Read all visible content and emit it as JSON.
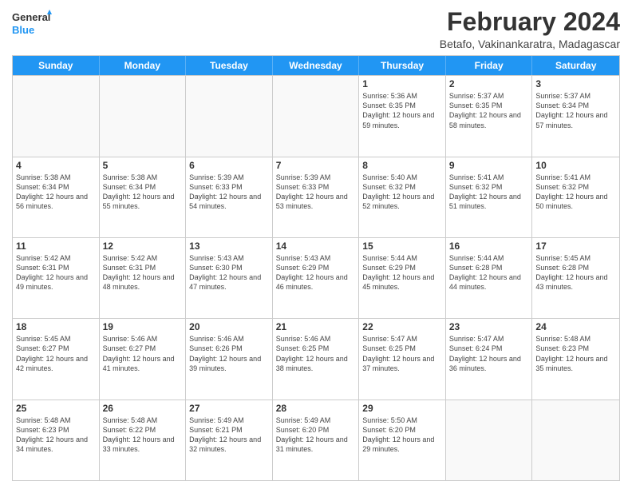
{
  "logo": {
    "text_general": "General",
    "text_blue": "Blue"
  },
  "header": {
    "title": "February 2024",
    "subtitle": "Betafo, Vakinankaratra, Madagascar"
  },
  "days_of_week": [
    "Sunday",
    "Monday",
    "Tuesday",
    "Wednesday",
    "Thursday",
    "Friday",
    "Saturday"
  ],
  "weeks": [
    [
      {
        "day": "",
        "detail": ""
      },
      {
        "day": "",
        "detail": ""
      },
      {
        "day": "",
        "detail": ""
      },
      {
        "day": "",
        "detail": ""
      },
      {
        "day": "1",
        "detail": "Sunrise: 5:36 AM\nSunset: 6:35 PM\nDaylight: 12 hours and 59 minutes."
      },
      {
        "day": "2",
        "detail": "Sunrise: 5:37 AM\nSunset: 6:35 PM\nDaylight: 12 hours and 58 minutes."
      },
      {
        "day": "3",
        "detail": "Sunrise: 5:37 AM\nSunset: 6:34 PM\nDaylight: 12 hours and 57 minutes."
      }
    ],
    [
      {
        "day": "4",
        "detail": "Sunrise: 5:38 AM\nSunset: 6:34 PM\nDaylight: 12 hours and 56 minutes."
      },
      {
        "day": "5",
        "detail": "Sunrise: 5:38 AM\nSunset: 6:34 PM\nDaylight: 12 hours and 55 minutes."
      },
      {
        "day": "6",
        "detail": "Sunrise: 5:39 AM\nSunset: 6:33 PM\nDaylight: 12 hours and 54 minutes."
      },
      {
        "day": "7",
        "detail": "Sunrise: 5:39 AM\nSunset: 6:33 PM\nDaylight: 12 hours and 53 minutes."
      },
      {
        "day": "8",
        "detail": "Sunrise: 5:40 AM\nSunset: 6:32 PM\nDaylight: 12 hours and 52 minutes."
      },
      {
        "day": "9",
        "detail": "Sunrise: 5:41 AM\nSunset: 6:32 PM\nDaylight: 12 hours and 51 minutes."
      },
      {
        "day": "10",
        "detail": "Sunrise: 5:41 AM\nSunset: 6:32 PM\nDaylight: 12 hours and 50 minutes."
      }
    ],
    [
      {
        "day": "11",
        "detail": "Sunrise: 5:42 AM\nSunset: 6:31 PM\nDaylight: 12 hours and 49 minutes."
      },
      {
        "day": "12",
        "detail": "Sunrise: 5:42 AM\nSunset: 6:31 PM\nDaylight: 12 hours and 48 minutes."
      },
      {
        "day": "13",
        "detail": "Sunrise: 5:43 AM\nSunset: 6:30 PM\nDaylight: 12 hours and 47 minutes."
      },
      {
        "day": "14",
        "detail": "Sunrise: 5:43 AM\nSunset: 6:29 PM\nDaylight: 12 hours and 46 minutes."
      },
      {
        "day": "15",
        "detail": "Sunrise: 5:44 AM\nSunset: 6:29 PM\nDaylight: 12 hours and 45 minutes."
      },
      {
        "day": "16",
        "detail": "Sunrise: 5:44 AM\nSunset: 6:28 PM\nDaylight: 12 hours and 44 minutes."
      },
      {
        "day": "17",
        "detail": "Sunrise: 5:45 AM\nSunset: 6:28 PM\nDaylight: 12 hours and 43 minutes."
      }
    ],
    [
      {
        "day": "18",
        "detail": "Sunrise: 5:45 AM\nSunset: 6:27 PM\nDaylight: 12 hours and 42 minutes."
      },
      {
        "day": "19",
        "detail": "Sunrise: 5:46 AM\nSunset: 6:27 PM\nDaylight: 12 hours and 41 minutes."
      },
      {
        "day": "20",
        "detail": "Sunrise: 5:46 AM\nSunset: 6:26 PM\nDaylight: 12 hours and 39 minutes."
      },
      {
        "day": "21",
        "detail": "Sunrise: 5:46 AM\nSunset: 6:25 PM\nDaylight: 12 hours and 38 minutes."
      },
      {
        "day": "22",
        "detail": "Sunrise: 5:47 AM\nSunset: 6:25 PM\nDaylight: 12 hours and 37 minutes."
      },
      {
        "day": "23",
        "detail": "Sunrise: 5:47 AM\nSunset: 6:24 PM\nDaylight: 12 hours and 36 minutes."
      },
      {
        "day": "24",
        "detail": "Sunrise: 5:48 AM\nSunset: 6:23 PM\nDaylight: 12 hours and 35 minutes."
      }
    ],
    [
      {
        "day": "25",
        "detail": "Sunrise: 5:48 AM\nSunset: 6:23 PM\nDaylight: 12 hours and 34 minutes."
      },
      {
        "day": "26",
        "detail": "Sunrise: 5:48 AM\nSunset: 6:22 PM\nDaylight: 12 hours and 33 minutes."
      },
      {
        "day": "27",
        "detail": "Sunrise: 5:49 AM\nSunset: 6:21 PM\nDaylight: 12 hours and 32 minutes."
      },
      {
        "day": "28",
        "detail": "Sunrise: 5:49 AM\nSunset: 6:20 PM\nDaylight: 12 hours and 31 minutes."
      },
      {
        "day": "29",
        "detail": "Sunrise: 5:50 AM\nSunset: 6:20 PM\nDaylight: 12 hours and 29 minutes."
      },
      {
        "day": "",
        "detail": ""
      },
      {
        "day": "",
        "detail": ""
      }
    ]
  ]
}
